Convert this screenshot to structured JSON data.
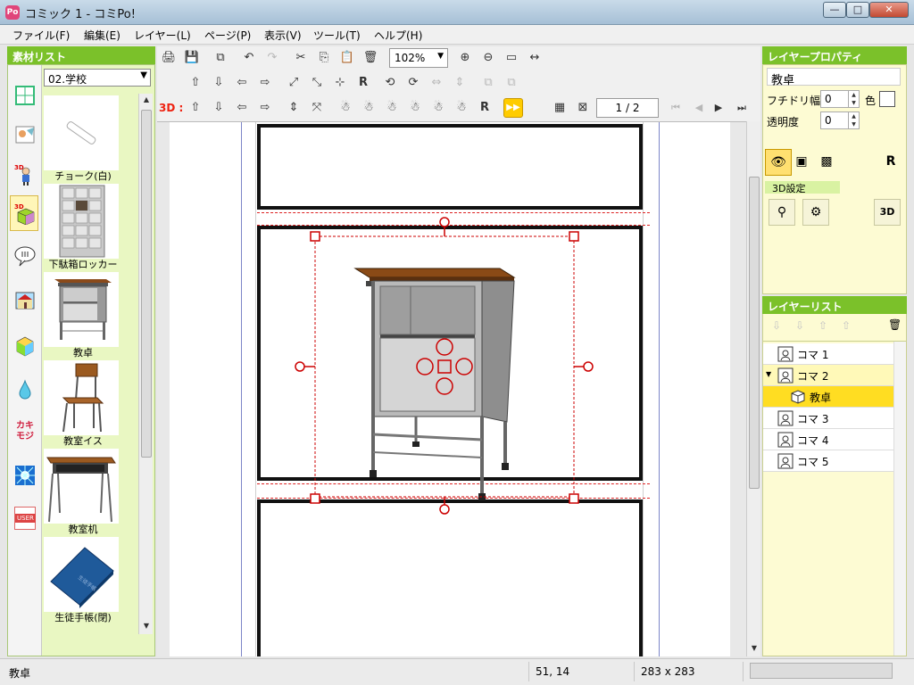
{
  "window": {
    "title": "コミック 1 - コミPo!",
    "app_icon": "Po",
    "minimize_glyph": "—",
    "maximize_glyph": "□",
    "close_glyph": "✕"
  },
  "menu": [
    {
      "label": "ファイル(F)"
    },
    {
      "label": "編集(E)"
    },
    {
      "label": "レイヤー(L)"
    },
    {
      "label": "ページ(P)"
    },
    {
      "label": "表示(V)"
    },
    {
      "label": "ツール(T)"
    },
    {
      "label": "ヘルプ(H)"
    }
  ],
  "materials": {
    "header": "素材リスト",
    "category": "02.学校",
    "items": [
      {
        "label": "チョーク(白)"
      },
      {
        "label": "下駄箱ロッカー"
      },
      {
        "label": "教卓"
      },
      {
        "label": "教室イス"
      },
      {
        "label": "教室机"
      },
      {
        "label": "生徒手帳(閉)"
      }
    ],
    "tools": [
      {
        "name": "panel-layout-tool-icon"
      },
      {
        "name": "background-tool-icon"
      },
      {
        "name": "3d-character-tool-icon",
        "badge": "3D"
      },
      {
        "name": "3d-object-tool-icon",
        "badge": "3D"
      },
      {
        "name": "speech-balloon-tool-icon"
      },
      {
        "name": "background-image-tool-icon"
      },
      {
        "name": "item-tool-icon"
      },
      {
        "name": "effect-drop-tool-icon"
      },
      {
        "name": "kaki-moji-tool-icon",
        "text": "カキモジ"
      },
      {
        "name": "flash-effect-tool-icon"
      },
      {
        "name": "user-material-tool-icon",
        "text": "USER"
      }
    ]
  },
  "toolbar": {
    "zoom": "102%",
    "label_3d": "3D :",
    "page_counter": "1 / 2",
    "row1": [
      "🖨",
      "💾",
      "⧉",
      "↶",
      "↷",
      "✂",
      "⎘",
      "📋",
      "🗑"
    ],
    "row2": [
      "⇧",
      "⇩",
      "⇦",
      "⇨",
      "⤢",
      "⤡",
      "⊹",
      "R",
      "⟲",
      "⟳",
      "⇔",
      "⇕",
      "⧉",
      "⧉"
    ],
    "row3": [
      "⇧",
      "⇩",
      "⇦",
      "⇨",
      "⇕",
      "⤧",
      "☃",
      "☃",
      "☃",
      "☃",
      "☃",
      "☃",
      "R",
      "▶▶"
    ],
    "nav_first": "⏮",
    "nav_prev": "◀",
    "nav_next": "▶",
    "nav_last": "⏭",
    "grid_icon": "▦",
    "no_image_icon": "⊠"
  },
  "canvas": {
    "selected_object": "教卓"
  },
  "properties": {
    "header": "レイヤープロパティ",
    "name": "教卓",
    "outline_width_label": "フチドリ幅",
    "outline_width_value": "0",
    "color_label": "色",
    "opacity_label": "透明度",
    "opacity_value": "0",
    "buttons": [
      "👁",
      "▣",
      "▩",
      "R"
    ],
    "section_3d": "3D設定",
    "buttons_3d": [
      "⚲",
      "⚙",
      "3D"
    ]
  },
  "layers": {
    "header": "レイヤーリスト",
    "toolbar_icons": [
      "⇩",
      "⇩",
      "⇧",
      "⇧",
      "🗑"
    ],
    "rows": [
      {
        "label": "コマ 1",
        "expanded": false,
        "depth": 0,
        "state": "normal"
      },
      {
        "label": "コマ 2",
        "expanded": true,
        "depth": 0,
        "state": "parent"
      },
      {
        "label": "教卓",
        "expanded": false,
        "depth": 1,
        "state": "selected"
      },
      {
        "label": "コマ 3",
        "expanded": false,
        "depth": 0,
        "state": "normal"
      },
      {
        "label": "コマ 4",
        "expanded": false,
        "depth": 0,
        "state": "normal"
      },
      {
        "label": "コマ 5",
        "expanded": false,
        "depth": 0,
        "state": "normal"
      }
    ]
  },
  "status": {
    "object_name": "教卓",
    "coords": "51, 14",
    "size": "283 x 283"
  }
}
